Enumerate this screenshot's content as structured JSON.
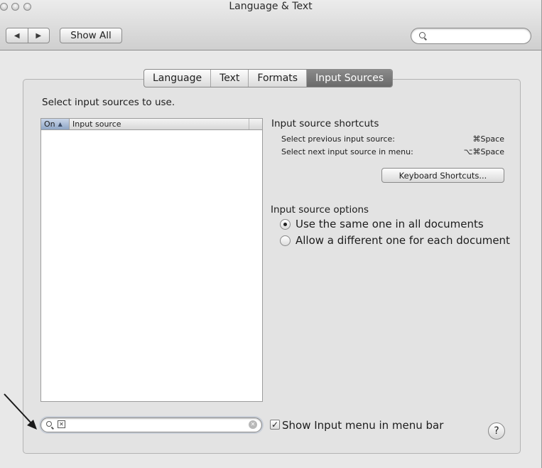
{
  "window": {
    "title": "Language & Text"
  },
  "toolbar": {
    "back_glyph": "◀",
    "forward_glyph": "▶",
    "show_all_label": "Show All",
    "search_placeholder": ""
  },
  "tabs": [
    "Language",
    "Text",
    "Formats",
    "Input Sources"
  ],
  "active_tab": "Input Sources",
  "input_sources": {
    "heading": "Select input sources to use.",
    "list_header": {
      "on": "On",
      "sort_glyph": "▲",
      "source": "Input source"
    },
    "rows": []
  },
  "shortcuts": {
    "title": "Input source shortcuts",
    "items": [
      {
        "label": "Select previous input source:",
        "keys": "⌘Space"
      },
      {
        "label": "Select next input source in menu:",
        "keys": "⌥⌘Space"
      }
    ],
    "keyboard_button": "Keyboard Shortcuts..."
  },
  "options": {
    "title": "Input source options",
    "radio": [
      {
        "label": "Use the same one in all documents",
        "selected": true
      },
      {
        "label": "Allow a different one for each document",
        "selected": false
      }
    ]
  },
  "bottom": {
    "search_value": "",
    "checkbox_label": "Show Input menu in menu bar",
    "checkbox_checked": true,
    "help_glyph": "?"
  },
  "colors": {
    "active_tab": "#7a7a7a",
    "list_header_selected": "#a9bbd6",
    "annotation_arrow": "#1a1a1a"
  }
}
